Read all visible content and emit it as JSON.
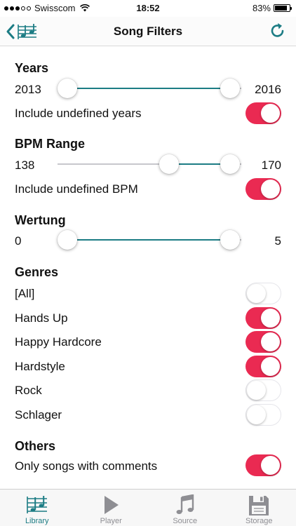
{
  "status_bar": {
    "carrier": "Swisscom",
    "time": "18:52",
    "battery_percent": "83%",
    "battery_level": 0.83
  },
  "nav": {
    "title": "Song Filters",
    "back_icon": "chevron-left-icon",
    "library_icon": "music-sheet-icon",
    "refresh_icon": "refresh-icon"
  },
  "sections": {
    "years": {
      "title": "Years",
      "min_value": "2013",
      "max_value": "2016",
      "include_label": "Include undefined years",
      "include_on": true
    },
    "bpm": {
      "title": "BPM Range",
      "min_value": "138",
      "max_value": "170",
      "include_label": "Include undefined BPM",
      "include_on": true
    },
    "rating": {
      "title": "Wertung",
      "min_value": "0",
      "max_value": "5"
    },
    "genres": {
      "title": "Genres",
      "items": [
        {
          "label": "[All]",
          "on": false
        },
        {
          "label": "Hands Up",
          "on": true
        },
        {
          "label": "Happy Hardcore",
          "on": true
        },
        {
          "label": "Hardstyle",
          "on": true
        },
        {
          "label": "Rock",
          "on": false
        },
        {
          "label": "Schlager",
          "on": false
        }
      ]
    },
    "others": {
      "title": "Others",
      "comments_label": "Only songs with comments",
      "comments_on": true
    }
  },
  "tabs": [
    {
      "label": "Library",
      "icon": "music-sheet-icon",
      "active": true
    },
    {
      "label": "Player",
      "icon": "play-icon",
      "active": false
    },
    {
      "label": "Source",
      "icon": "music-note-icon",
      "active": false
    },
    {
      "label": "Storage",
      "icon": "floppy-disk-icon",
      "active": false
    }
  ],
  "colors": {
    "accent": "#1c7c84",
    "toggle_on": "#ea2a52",
    "inactive": "#8e8e93"
  }
}
